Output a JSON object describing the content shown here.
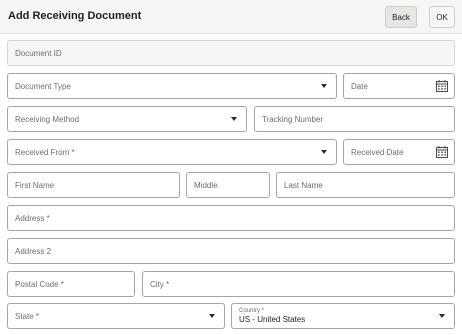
{
  "header": {
    "title": "Add Receiving Document",
    "back_label": "Back",
    "ok_label": "OK"
  },
  "form": {
    "document_id": "Document ID",
    "document_type": "Document Type",
    "date": "Date",
    "receiving_method": "Receiving Method",
    "tracking_number": "Tracking Number",
    "received_from": "Received From *",
    "received_date": "Received Date",
    "first_name": "First Name",
    "middle": "Middle",
    "last_name": "Last Name",
    "address1": "Address *",
    "address2": "Address 2",
    "postal_code": "Postal Code *",
    "city": "City *",
    "state": "State *",
    "country_label": "Country *",
    "country_value": "US - United States"
  },
  "icons": {
    "dropdown": "chevron-down-icon",
    "calendar": "calendar-icon"
  }
}
